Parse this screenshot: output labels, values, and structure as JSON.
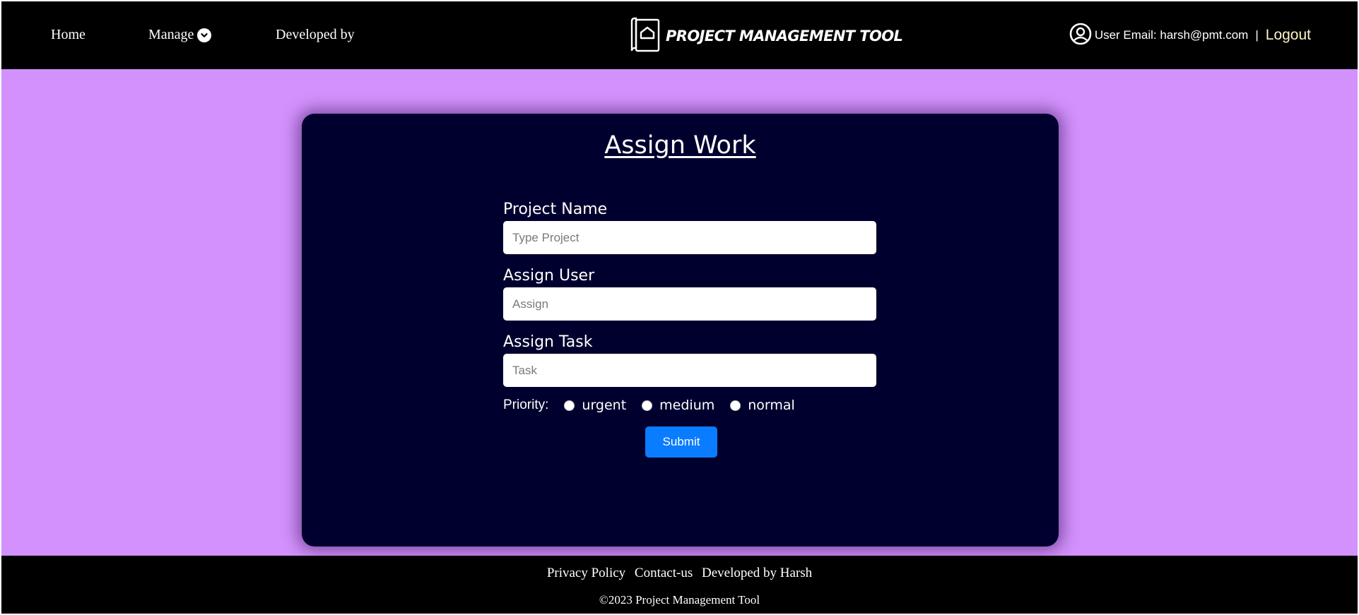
{
  "nav": {
    "home": "Home",
    "manage": "Manage",
    "developed_by": "Developed by"
  },
  "brand": {
    "title": "PROJECT MANAGEMENT TOOL",
    "icon": "book-house-logo-icon"
  },
  "user": {
    "email_label": "User Email: harsh@pmt.com",
    "separator": "|",
    "logout": "Logout",
    "icon": "user-circle-icon"
  },
  "card": {
    "title": "Assign Work",
    "fields": [
      {
        "label": "Project Name",
        "placeholder": "Type Project",
        "value": ""
      },
      {
        "label": "Assign User",
        "placeholder": "Assign",
        "value": ""
      },
      {
        "label": "Assign Task",
        "placeholder": "Task",
        "value": ""
      }
    ],
    "priority_label": "Priority:",
    "priority_options": [
      "urgent",
      "medium",
      "normal"
    ],
    "submit": "Submit"
  },
  "footer": {
    "links": [
      "Privacy Policy",
      "Contact-us",
      "Developed by Harsh"
    ],
    "copyright": "©2023 Project Management Tool"
  },
  "colors": {
    "page_background": "#d291fc",
    "header_background": "#000000",
    "card_background": "#00002e",
    "button": "#0a7cff",
    "logout_text": "#fff3c4"
  }
}
